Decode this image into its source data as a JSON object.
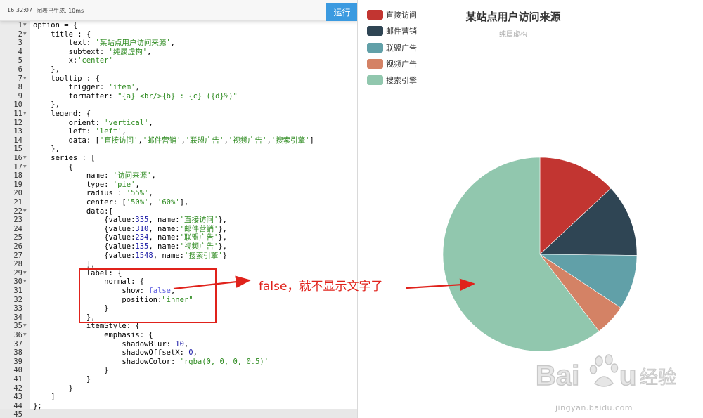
{
  "toolbar": {
    "time": "16:32:07",
    "status": "图表已生成, 10ms",
    "run_label": "运行"
  },
  "code_lines": [
    "option = {",
    "    title : {",
    "        text: '某站点用户访问来源',",
    "        subtext: '纯属虚构',",
    "        x:'center'",
    "    },",
    "    tooltip : {",
    "        trigger: 'item',",
    "        formatter: \"{a} <br/>{b} : {c} ({d}%)\"",
    "    },",
    "    legend: {",
    "        orient: 'vertical',",
    "        left: 'left',",
    "        data: ['直接访问','邮件营销','联盟广告','视频广告','搜索引擎']",
    "    },",
    "    series : [",
    "        {",
    "            name: '访问来源',",
    "            type: 'pie',",
    "            radius : '55%',",
    "            center: ['50%', '60%'],",
    "            data:[",
    "                {value:335, name:'直接访问'},",
    "                {value:310, name:'邮件营销'},",
    "                {value:234, name:'联盟广告'},",
    "                {value:135, name:'视频广告'},",
    "                {value:1548, name:'搜索引擎'}",
    "            ],",
    "            label: {",
    "                normal: {",
    "                    show: false,",
    "                    position:\"inner\"",
    "                }",
    "            },",
    "            itemStyle: {",
    "                emphasis: {",
    "                    shadowBlur: 10,",
    "                    shadowOffsetX: 0,",
    "                    shadowColor: 'rgba(0, 0, 0, 0.5)'",
    "                }",
    "            }",
    "        }",
    "    ]",
    "};",
    ""
  ],
  "fold_lines": [
    1,
    2,
    7,
    11,
    16,
    17,
    22,
    29,
    30,
    35,
    36
  ],
  "annotation": {
    "text": "false，就不显示文字了"
  },
  "chart_data": {
    "type": "pie",
    "title": "某站点用户访问来源",
    "subtitle": "纯属虚构",
    "legend_position": "top-left",
    "legend_orient": "vertical",
    "series_name": "访问来源",
    "labels_shown": false,
    "categories": [
      "直接访问",
      "邮件营销",
      "联盟广告",
      "视频广告",
      "搜索引擎"
    ],
    "values": [
      335,
      310,
      234,
      135,
      1548
    ],
    "colors": [
      "#c23531",
      "#2f4554",
      "#61a0a8",
      "#d48265",
      "#91c7ae"
    ]
  },
  "watermark": {
    "brand": "Bai du 经验",
    "url": "jingyan.baidu.com"
  },
  "colors": {
    "accent": "#3b9ae0",
    "annotation": "#e0221b"
  }
}
